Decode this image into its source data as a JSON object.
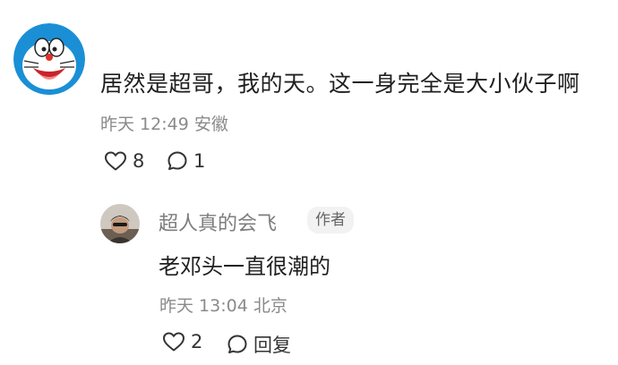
{
  "comment": {
    "text": "居然是超哥，我的天。这一身完全是大小伙子啊",
    "time": "昨天 12:49",
    "location": "安徽",
    "likes": "8",
    "replies": "1"
  },
  "reply": {
    "author": "超人真的会飞",
    "badge": "作者",
    "text": "老邓头一直很潮的",
    "time": "昨天 13:04",
    "location": "北京",
    "likes": "2",
    "reply_label": "回复"
  },
  "icons": {
    "like": "heart-outline-icon",
    "comment": "speech-bubble-icon"
  },
  "colors": {
    "primary_text": "#1f1f1f",
    "secondary_text": "#8a8a8a",
    "badge_bg": "#f2f2f2"
  }
}
